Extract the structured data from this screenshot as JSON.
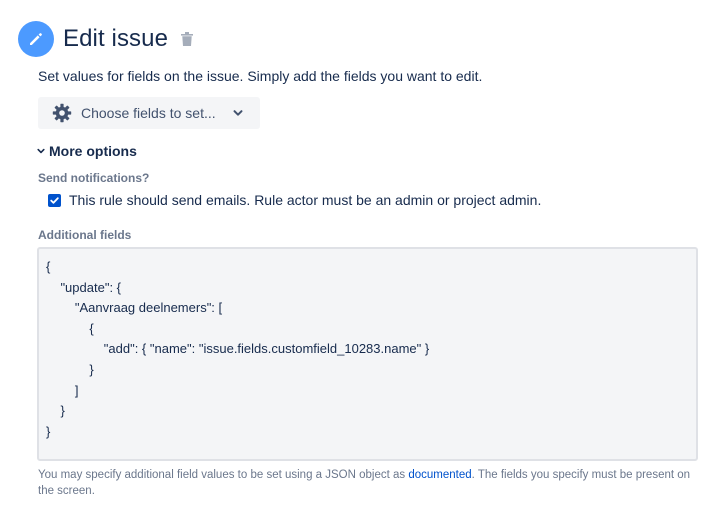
{
  "header": {
    "title": "Edit issue",
    "icon": "pencil-icon",
    "delete_icon": "trash-icon"
  },
  "description": "Set values for fields on the issue. Simply add the fields you want to edit.",
  "choose_fields": {
    "label": "Choose fields to set...",
    "icon": "gear-icon"
  },
  "more_options": {
    "label": "More options"
  },
  "send_notifications": {
    "label": "Send notifications?",
    "checkbox_label": "This rule should send emails. Rule actor must be an admin or project admin.",
    "checked": true
  },
  "additional_fields": {
    "label": "Additional fields",
    "value": "{\n    \"update\": {\n        \"Aanvraag deelnemers\": [\n            {\n                \"add\": { \"name\": \"issue.fields.customfield_10283.name\" }\n            }\n        ]\n    }\n}"
  },
  "help": {
    "text_before": "You may specify additional field values to be set using a JSON object as ",
    "link": "documented",
    "text_after": ". The fields you specify must be present on the screen."
  },
  "colors": {
    "accent": "#4c9aff",
    "checkbox": "#0052cc",
    "link": "#0052cc",
    "text": "#172b4d",
    "muted": "#6b778c"
  }
}
